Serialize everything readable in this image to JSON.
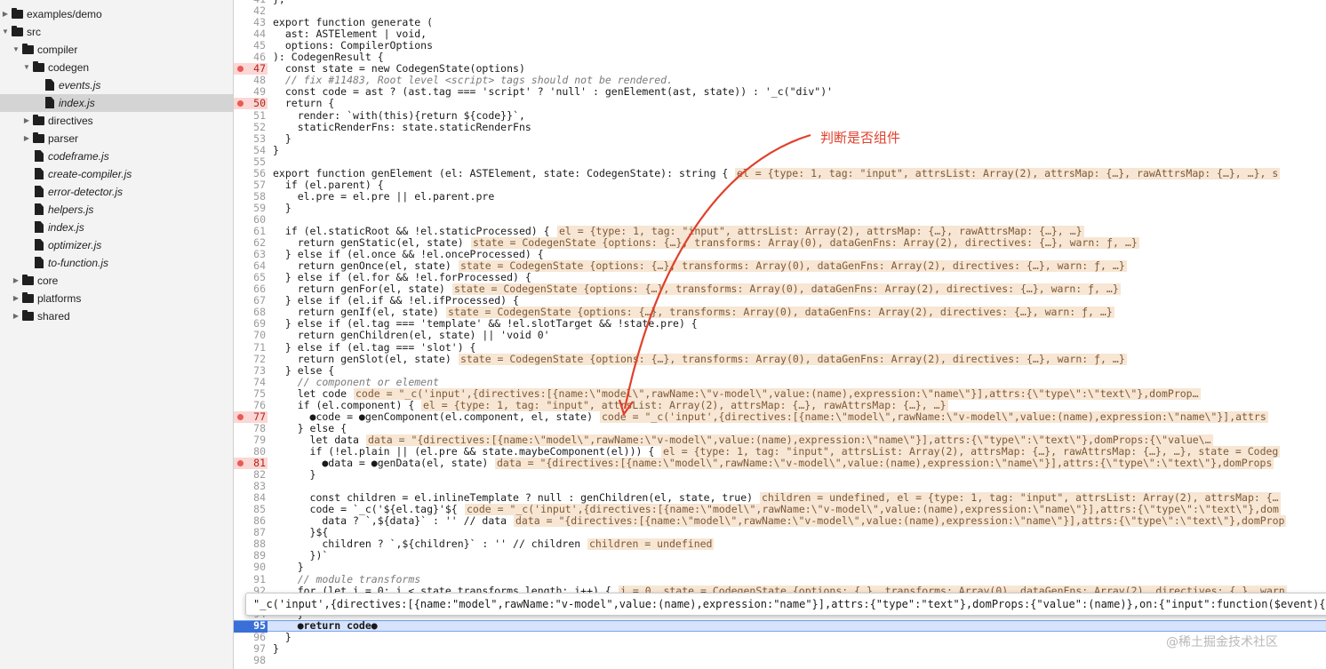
{
  "sidebar": {
    "items": [
      {
        "label": "examples/demo",
        "kind": "folder",
        "expanded": false,
        "depth": 0
      },
      {
        "label": "src",
        "kind": "folder",
        "expanded": true,
        "depth": 0
      },
      {
        "label": "compiler",
        "kind": "folder",
        "expanded": true,
        "depth": 1
      },
      {
        "label": "codegen",
        "kind": "folder",
        "expanded": true,
        "depth": 2
      },
      {
        "label": "events.js",
        "kind": "file",
        "depth": 3
      },
      {
        "label": "index.js",
        "kind": "file",
        "depth": 3,
        "selected": true
      },
      {
        "label": "directives",
        "kind": "folder",
        "expanded": false,
        "depth": 2
      },
      {
        "label": "parser",
        "kind": "folder",
        "expanded": false,
        "depth": 2
      },
      {
        "label": "codeframe.js",
        "kind": "file",
        "depth": 2
      },
      {
        "label": "create-compiler.js",
        "kind": "file",
        "depth": 2
      },
      {
        "label": "error-detector.js",
        "kind": "file",
        "depth": 2
      },
      {
        "label": "helpers.js",
        "kind": "file",
        "depth": 2
      },
      {
        "label": "index.js",
        "kind": "file",
        "depth": 2
      },
      {
        "label": "optimizer.js",
        "kind": "file",
        "depth": 2
      },
      {
        "label": "to-function.js",
        "kind": "file",
        "depth": 2
      },
      {
        "label": "core",
        "kind": "folder",
        "expanded": false,
        "depth": 1
      },
      {
        "label": "platforms",
        "kind": "folder",
        "expanded": false,
        "depth": 1
      },
      {
        "label": "shared",
        "kind": "folder",
        "expanded": false,
        "depth": 1
      }
    ]
  },
  "editor": {
    "lines": [
      {
        "n": "41",
        "code": "},"
      },
      {
        "n": "42",
        "code": ""
      },
      {
        "n": "43",
        "code": "export function generate ("
      },
      {
        "n": "44",
        "code": "  ast: ASTElement | void,"
      },
      {
        "n": "45",
        "code": "  options: CompilerOptions"
      },
      {
        "n": "46",
        "code": "): CodegenResult {"
      },
      {
        "n": "47",
        "code": "  const state = new CodegenState(options)",
        "bp": true
      },
      {
        "n": "48",
        "code": "  // fix #11483, Root level <script> tags should not be rendered.",
        "comment": true
      },
      {
        "n": "49",
        "code": "  const code = ast ? (ast.tag === 'script' ? 'null' : genElement(ast, state)) : '_c(\"div\")'"
      },
      {
        "n": "50",
        "code": "  return {",
        "bp": true
      },
      {
        "n": "51",
        "code": "    render: `with(this){return ${code}}`,"
      },
      {
        "n": "52",
        "code": "    staticRenderFns: state.staticRenderFns"
      },
      {
        "n": "53",
        "code": "  }"
      },
      {
        "n": "54",
        "code": "}"
      },
      {
        "n": "55",
        "code": ""
      },
      {
        "n": "56",
        "code": "export function genElement (el: ASTElement, state: CodegenState): string {",
        "val": "el = {type: 1, tag: \"input\", attrsList: Array(2), attrsMap: {…}, rawAttrsMap: {…}, …}, s"
      },
      {
        "n": "57",
        "code": "  if (el.parent) {"
      },
      {
        "n": "58",
        "code": "    el.pre = el.pre || el.parent.pre"
      },
      {
        "n": "59",
        "code": "  }"
      },
      {
        "n": "60",
        "code": ""
      },
      {
        "n": "61",
        "code": "  if (el.staticRoot && !el.staticProcessed) {",
        "val": "el = {type: 1, tag: \"input\", attrsList: Array(2), attrsMap: {…}, rawAttrsMap: {…}, …}"
      },
      {
        "n": "62",
        "code": "    return genStatic(el, state)",
        "val": "state = CodegenState {options: {…}, transforms: Array(0), dataGenFns: Array(2), directives: {…}, warn: ƒ, …}"
      },
      {
        "n": "63",
        "code": "  } else if (el.once && !el.onceProcessed) {"
      },
      {
        "n": "64",
        "code": "    return genOnce(el, state)",
        "val": "state = CodegenState {options: {…}, transforms: Array(0), dataGenFns: Array(2), directives: {…}, warn: ƒ, …}"
      },
      {
        "n": "65",
        "code": "  } else if (el.for && !el.forProcessed) {"
      },
      {
        "n": "66",
        "code": "    return genFor(el, state)",
        "val": "state = CodegenState {options: {…}, transforms: Array(0), dataGenFns: Array(2), directives: {…}, warn: ƒ, …}"
      },
      {
        "n": "67",
        "code": "  } else if (el.if && !el.ifProcessed) {"
      },
      {
        "n": "68",
        "code": "    return genIf(el, state)",
        "val": "state = CodegenState {options: {…}, transforms: Array(0), dataGenFns: Array(2), directives: {…}, warn: ƒ, …}"
      },
      {
        "n": "69",
        "code": "  } else if (el.tag === 'template' && !el.slotTarget && !state.pre) {"
      },
      {
        "n": "70",
        "code": "    return genChildren(el, state) || 'void 0'"
      },
      {
        "n": "71",
        "code": "  } else if (el.tag === 'slot') {"
      },
      {
        "n": "72",
        "code": "    return genSlot(el, state)",
        "val": "state = CodegenState {options: {…}, transforms: Array(0), dataGenFns: Array(2), directives: {…}, warn: ƒ, …}"
      },
      {
        "n": "73",
        "code": "  } else {"
      },
      {
        "n": "74",
        "code": "    // component or element",
        "comment": true
      },
      {
        "n": "75",
        "code": "    let code",
        "val": "code = \"_c('input',{directives:[{name:\\\"model\\\",rawName:\\\"v-model\\\",value:(name),expression:\\\"name\\\"}],attrs:{\\\"type\\\":\\\"text\\\"},domProp…"
      },
      {
        "n": "76",
        "code": "    if (el.component) {",
        "val": "el = {type: 1, tag: \"input\", attrsList: Array(2), attrsMap: {…}, rawAttrsMap: {…}, …}"
      },
      {
        "n": "77",
        "code": "      ●code = ●genComponent(el.component, el, state)",
        "bp": true,
        "val": "code = \"_c('input',{directives:[{name:\\\"model\\\",rawName:\\\"v-model\\\",value:(name),expression:\\\"name\\\"}],attrs"
      },
      {
        "n": "78",
        "code": "    } else {"
      },
      {
        "n": "79",
        "code": "      let data",
        "val": "data = \"{directives:[{name:\\\"model\\\",rawName:\\\"v-model\\\",value:(name),expression:\\\"name\\\"}],attrs:{\\\"type\\\":\\\"text\\\"},domProps:{\\\"value\\…"
      },
      {
        "n": "80",
        "code": "      if (!el.plain || (el.pre && state.maybeComponent(el))) {",
        "val": "el = {type: 1, tag: \"input\", attrsList: Array(2), attrsMap: {…}, rawAttrsMap: {…}, …}, state = Codeg"
      },
      {
        "n": "81",
        "code": "        ●data = ●genData(el, state)",
        "bp": true,
        "val": "data = \"{directives:[{name:\\\"model\\\",rawName:\\\"v-model\\\",value:(name),expression:\\\"name\\\"}],attrs:{\\\"type\\\":\\\"text\\\"},domProps"
      },
      {
        "n": "82",
        "code": "      }"
      },
      {
        "n": "83",
        "code": ""
      },
      {
        "n": "84",
        "code": "      const children = el.inlineTemplate ? null : genChildren(el, state, true)",
        "val": "children = undefined, el = {type: 1, tag: \"input\", attrsList: Array(2), attrsMap: {…"
      },
      {
        "n": "85",
        "code": "      code = `_c('${el.tag}'${",
        "val": "code = \"_c('input',{directives:[{name:\\\"model\\\",rawName:\\\"v-model\\\",value:(name),expression:\\\"name\\\"}],attrs:{\\\"type\\\":\\\"text\\\"},dom"
      },
      {
        "n": "86",
        "code": "        data ? `,${data}` : '' // data",
        "val": "data = \"{directives:[{name:\\\"model\\\",rawName:\\\"v-model\\\",value:(name),expression:\\\"name\\\"}],attrs:{\\\"type\\\":\\\"text\\\"},domProp"
      },
      {
        "n": "87",
        "code": "      }${"
      },
      {
        "n": "88",
        "code": "        children ? `,${children}` : '' // children",
        "val": "children = undefined"
      },
      {
        "n": "89",
        "code": "      })`"
      },
      {
        "n": "90",
        "code": "    }"
      },
      {
        "n": "91",
        "code": "    // module transforms",
        "comment": true
      },
      {
        "n": "92",
        "code": "    for (let i = 0; i < state.transforms.length; i++) {",
        "val": "i = 0, state = CodegenState {options: {…}, transforms: Array(0), dataGenFns: Array(2), directives: {…}, warn"
      },
      {
        "n": "93",
        "code": ""
      },
      {
        "n": "94",
        "code": "    }"
      },
      {
        "n": "95",
        "code": "    ●return code●",
        "bp": true,
        "current": true
      },
      {
        "n": "96",
        "code": "  }"
      },
      {
        "n": "97",
        "code": "}"
      },
      {
        "n": "98",
        "code": ""
      }
    ]
  },
  "hover_popup": {
    "text": "\"_c('input',{directives:[{name:\"model\",rawName:\"v-model\",value:(name),expression:\"name\"}],attrs:{\"type\":\"text\"},domProps:{\"value\":(name)},on:{\"input\":function($event){"
  },
  "annotation": {
    "label": "判断是否组件",
    "color": "#e0402c"
  },
  "watermark": "@稀土掘金技术社区"
}
